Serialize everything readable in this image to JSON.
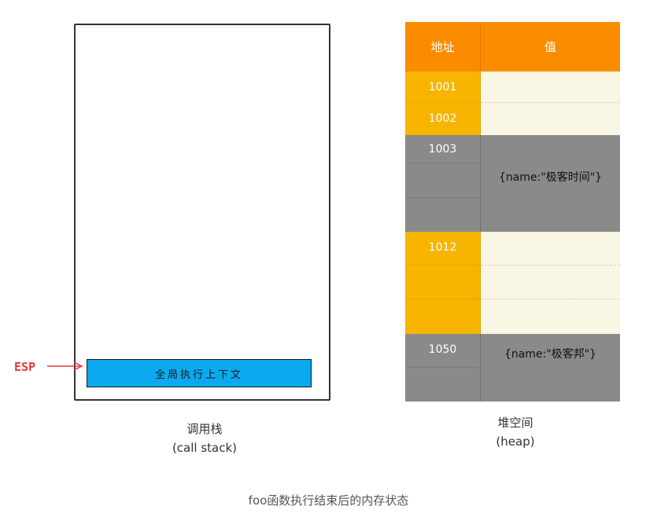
{
  "call_stack": {
    "esp_label": "ESP",
    "frames": [
      "全局执行上下文"
    ],
    "caption_line1": "调用栈",
    "caption_line2": "(call stack)"
  },
  "heap": {
    "header_address": "地址",
    "header_value": "值",
    "rows": [
      {
        "address": "1001",
        "color": "#f7b500"
      },
      {
        "address": "1002",
        "color": "#f7b500"
      },
      {
        "address": "1003",
        "color": "#8a8a8a"
      },
      {
        "address": "",
        "color": "#8a8a8a"
      },
      {
        "address": "",
        "color": "#8a8a8a"
      },
      {
        "address": "1012",
        "color": "#f7b500"
      },
      {
        "address": "",
        "color": "#f7b500"
      },
      {
        "address": "",
        "color": "#f7b500"
      },
      {
        "address": "1050",
        "color": "#8a8a8a"
      },
      {
        "address": "",
        "color": "#8a8a8a"
      }
    ],
    "objects": [
      {
        "value": "{name:\"极客时间\"}"
      },
      {
        "value": "{name:\"极客邦\"}"
      }
    ],
    "caption_line1": "堆空间",
    "caption_line2": "(heap)"
  },
  "footer_caption": "foo函数执行结束后的内存状态"
}
